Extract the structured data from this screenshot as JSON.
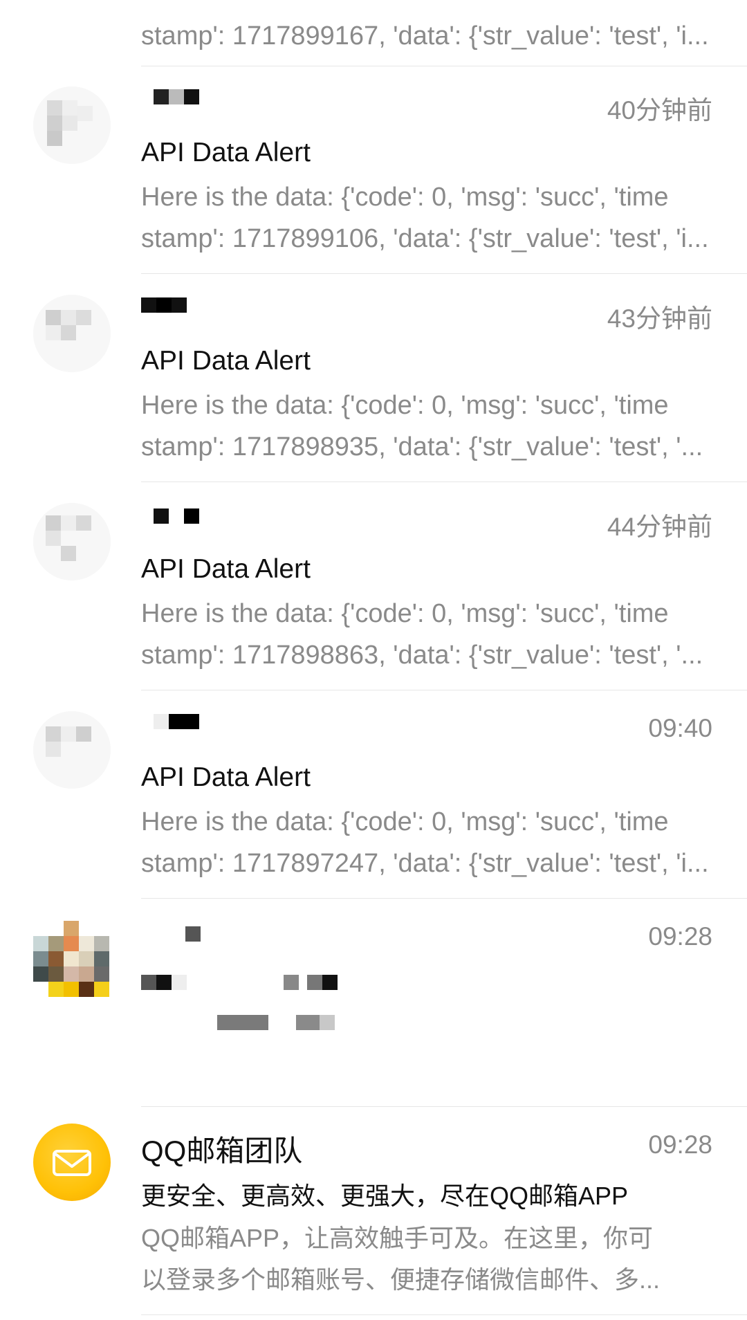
{
  "emails": [
    {
      "preview_line2": "stamp': 1717899167, 'data': {'str_value': 'test', 'i..."
    },
    {
      "sender": "",
      "time": "40分钟前",
      "subject": "API Data Alert",
      "preview_line1": "Here is the data: {'code': 0, 'msg': 'succ', 'time",
      "preview_line2": "stamp': 1717899106, 'data': {'str_value': 'test', 'i..."
    },
    {
      "sender": "",
      "time": "43分钟前",
      "subject": "API Data Alert",
      "preview_line1": "Here is the data: {'code': 0, 'msg': 'succ', 'time",
      "preview_line2": "stamp': 1717898935, 'data': {'str_value': 'test', '..."
    },
    {
      "sender": "",
      "time": "44分钟前",
      "subject": "API Data Alert",
      "preview_line1": "Here is the data: {'code': 0, 'msg': 'succ', 'time",
      "preview_line2": "stamp': 1717898863, 'data': {'str_value': 'test', '..."
    },
    {
      "sender": "",
      "time": "09:40",
      "subject": "API Data Alert",
      "preview_line1": "Here is the data: {'code': 0, 'msg': 'succ', 'time",
      "preview_line2": "stamp': 1717897247, 'data': {'str_value': 'test', 'i..."
    },
    {
      "sender": "",
      "time": "09:28",
      "subject": "",
      "preview_line1": "",
      "preview_line2": ""
    },
    {
      "sender": "QQ邮箱团队",
      "time": "09:28",
      "subject": "更安全、更高效、更强大，尽在QQ邮箱APP",
      "preview_line1": "QQ邮箱APP，让高效触手可及。在这里，你可",
      "preview_line2": "以登录多个邮箱账号、便捷存储微信邮件、多..."
    }
  ],
  "icons": {
    "qq_mail_avatar": "envelope-icon"
  },
  "colors": {
    "primary_text": "#111111",
    "secondary_text": "#8a8a8a",
    "divider": "#e6e6e6",
    "qq_mail_yellow": "#ffc107"
  }
}
